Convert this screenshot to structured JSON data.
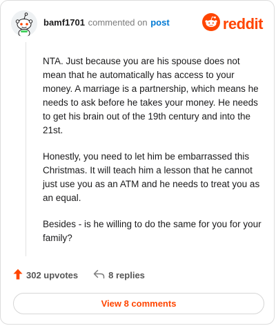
{
  "comment": {
    "username": "bamf1701",
    "action_text": "commented on",
    "post_link_label": "post"
  },
  "brand": {
    "name": "reddit",
    "color": "#ff4500"
  },
  "body": {
    "paragraphs": [
      "NTA. Just because you are his spouse does not mean that he automatically has access to your money. A marriage is a partnership, which means he needs to ask before he takes your money. He needs to get his brain out of the 19th century and into the 21st.",
      "Honestly, you need to let him be embarrassed this Christmas. It will teach him a lesson that he cannot just use you as an ATM and he needs to treat you as an equal.",
      "Besides - is he willing to do the same for you for your family?"
    ]
  },
  "stats": {
    "upvotes_label": "302 upvotes",
    "replies_label": "8 replies"
  },
  "actions": {
    "view_comments_label": "View 8 comments"
  },
  "icons": {
    "avatar": "snoo-avatar-icon",
    "brand": "reddit-logo-icon",
    "upvote": "upvote-arrow-icon",
    "reply": "reply-arrow-icon"
  },
  "colors": {
    "accent": "#ff4500",
    "link": "#0079d3",
    "muted": "#7c7c7c"
  }
}
